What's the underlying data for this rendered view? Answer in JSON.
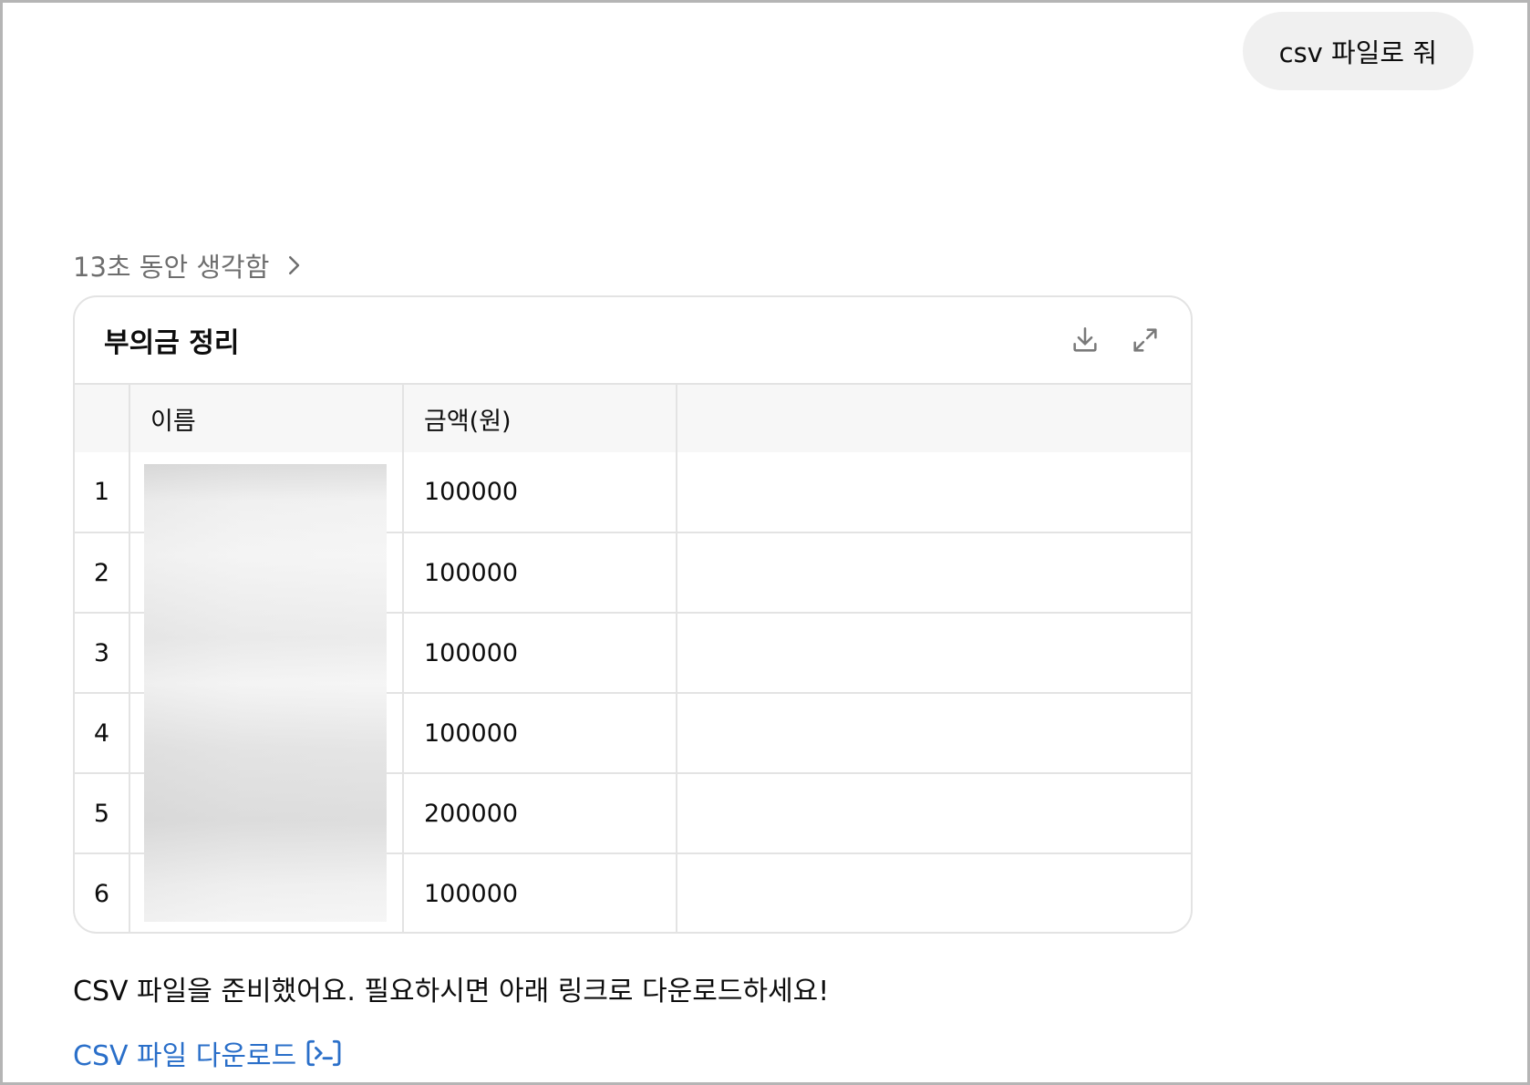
{
  "user_message": "csv 파일로 줘",
  "thought": {
    "label": "13초 동안 생각함"
  },
  "card": {
    "title": "부의금 정리",
    "columns": [
      "",
      "이름",
      "금액(원)",
      ""
    ],
    "rows": [
      {
        "index": "1",
        "name": "",
        "amount": "100000"
      },
      {
        "index": "2",
        "name": "",
        "amount": "100000"
      },
      {
        "index": "3",
        "name": "",
        "amount": "100000"
      },
      {
        "index": "4",
        "name": "",
        "amount": "100000"
      },
      {
        "index": "5",
        "name": "",
        "amount": "200000"
      },
      {
        "index": "6",
        "name": "",
        "amount": "100000"
      }
    ]
  },
  "assistant": {
    "message": "CSV 파일을 준비했어요. 필요하시면 아래 링크로 다운로드하세요!",
    "link_label": "CSV 파일 다운로드"
  },
  "icons": {
    "download": "download-icon",
    "expand": "expand-icon",
    "chevron": "chevron-right-icon",
    "code": "code-icon"
  },
  "colors": {
    "link": "#2a6fc9",
    "bubble": "#f0f0f0",
    "muted": "#6e6e6e",
    "border": "#e3e3e3"
  }
}
